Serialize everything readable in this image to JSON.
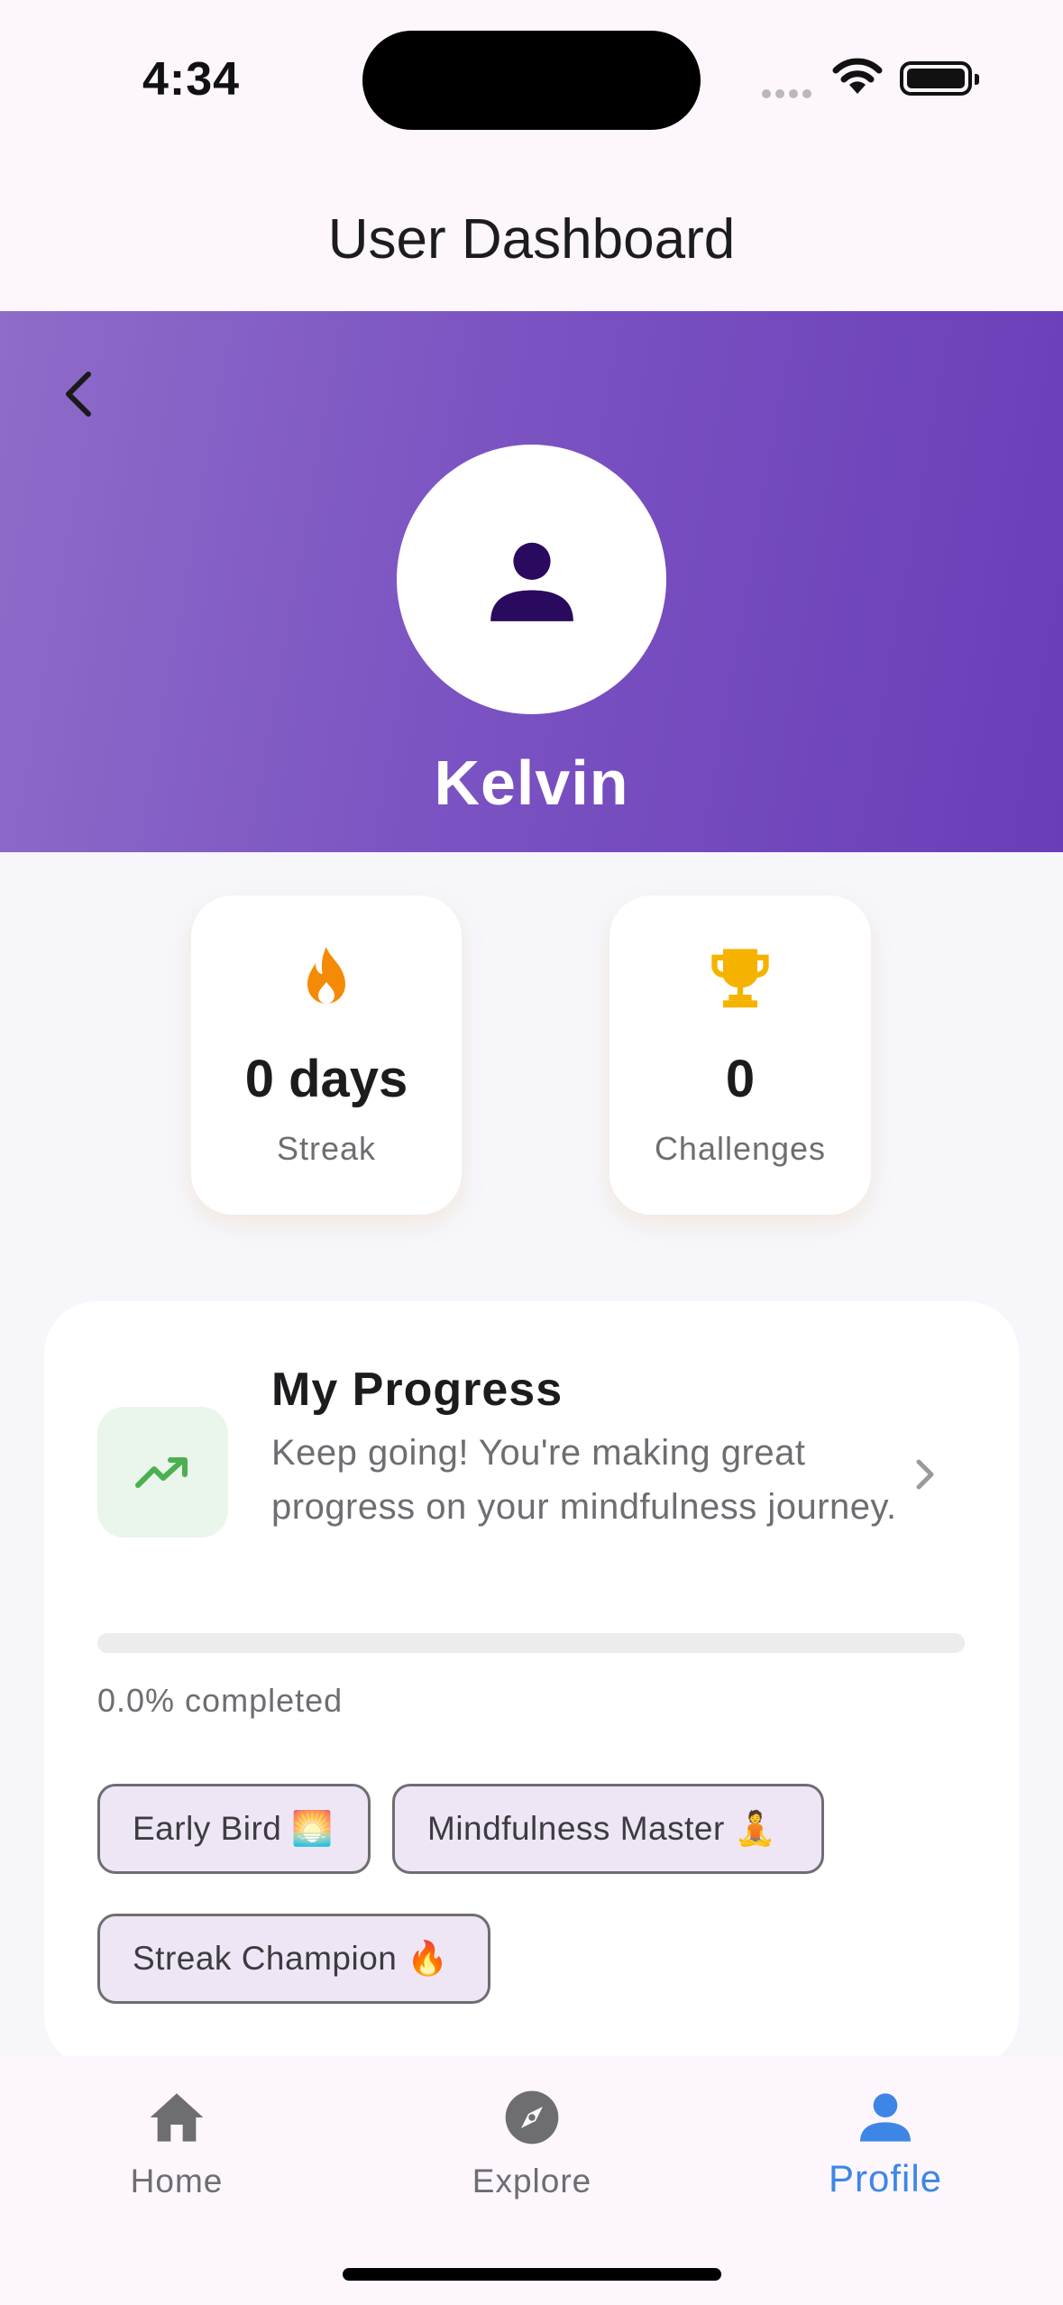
{
  "status_bar": {
    "time": "4:34"
  },
  "app_bar": {
    "title": "User Dashboard"
  },
  "profile": {
    "name": "Kelvin"
  },
  "stats": [
    {
      "value": "0 days",
      "label": "Streak",
      "icon": "fire-icon",
      "color": "#f58a07"
    },
    {
      "value": "0",
      "label": "Challenges",
      "icon": "trophy-icon",
      "color": "#f5b300"
    }
  ],
  "progress": {
    "title": "My Progress",
    "description": "Keep going! You're making great progress on your mindfulness journey.",
    "percent_text": "0.0% completed",
    "percent": 0,
    "icon": "trending-up-icon",
    "accent": "#4caf50"
  },
  "badges": [
    {
      "label": "Early Bird 🌅"
    },
    {
      "label": "Mindfulness Master 🧘"
    },
    {
      "label": "Streak Champion 🔥"
    }
  ],
  "bottom_nav": {
    "items": [
      {
        "label": "Home",
        "icon": "home-icon",
        "active": false
      },
      {
        "label": "Explore",
        "icon": "compass-icon",
        "active": false
      },
      {
        "label": "Profile",
        "icon": "person-icon",
        "active": true
      }
    ],
    "active_color": "#3d86e6"
  },
  "theme": {
    "header_gradient_start": "#8e6cc9",
    "header_gradient_end": "#6a3db8",
    "avatar_icon_color": "#2a0a5e"
  }
}
